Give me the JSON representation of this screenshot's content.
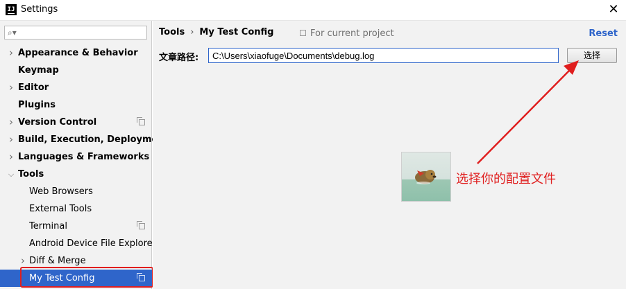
{
  "window": {
    "title": "Settings",
    "app_icon_text": "IJ"
  },
  "sidebar": {
    "search": {
      "value": "",
      "placeholder": ""
    },
    "items": [
      {
        "label": "Appearance & Behavior",
        "bold": true,
        "expandable": true,
        "expanded": false,
        "level": 0,
        "project_scope": false
      },
      {
        "label": "Keymap",
        "bold": true,
        "expandable": false,
        "level": 0,
        "project_scope": false
      },
      {
        "label": "Editor",
        "bold": true,
        "expandable": true,
        "expanded": false,
        "level": 0,
        "project_scope": false
      },
      {
        "label": "Plugins",
        "bold": true,
        "expandable": false,
        "level": 0,
        "project_scope": false
      },
      {
        "label": "Version Control",
        "bold": true,
        "expandable": true,
        "expanded": false,
        "level": 0,
        "project_scope": true
      },
      {
        "label": "Build, Execution, Deployment",
        "bold": true,
        "expandable": true,
        "expanded": false,
        "level": 0,
        "project_scope": false
      },
      {
        "label": "Languages & Frameworks",
        "bold": true,
        "expandable": true,
        "expanded": false,
        "level": 0,
        "project_scope": false
      },
      {
        "label": "Tools",
        "bold": true,
        "expandable": true,
        "expanded": true,
        "level": 0,
        "project_scope": false
      },
      {
        "label": "Web Browsers",
        "bold": false,
        "expandable": false,
        "level": 1,
        "project_scope": false
      },
      {
        "label": "External Tools",
        "bold": false,
        "expandable": false,
        "level": 1,
        "project_scope": false
      },
      {
        "label": "Terminal",
        "bold": false,
        "expandable": false,
        "level": 1,
        "project_scope": true
      },
      {
        "label": "Android Device File Explorer",
        "bold": false,
        "expandable": false,
        "level": 1,
        "project_scope": false
      },
      {
        "label": "Diff & Merge",
        "bold": false,
        "expandable": true,
        "expanded": false,
        "level": 1,
        "project_scope": false
      },
      {
        "label": "My Test Config",
        "bold": false,
        "expandable": false,
        "level": 1,
        "project_scope": true,
        "selected": true
      }
    ]
  },
  "main": {
    "breadcrumb": {
      "parent": "Tools",
      "separator": "›",
      "current": "My Test Config"
    },
    "scope_label": "For current project",
    "reset_label": "Reset",
    "path_label": "文章路径:",
    "path_value": "C:\\Users\\xiaofuge\\Documents\\debug.log",
    "choose_button": "选择"
  },
  "annotation": {
    "text": "选择你的配置文件",
    "color": "#e01e1e"
  },
  "colors": {
    "accent": "#2f65ca",
    "sidebar_bg": "#f2f2f2",
    "selection_bg": "#2f65ca",
    "highlight_red": "#e01e1e"
  },
  "icons": {
    "close": "close-icon",
    "search": "search-icon",
    "expand": "chevron-right-icon",
    "collapse": "chevron-down-icon",
    "project_scope": "copy-icon"
  }
}
